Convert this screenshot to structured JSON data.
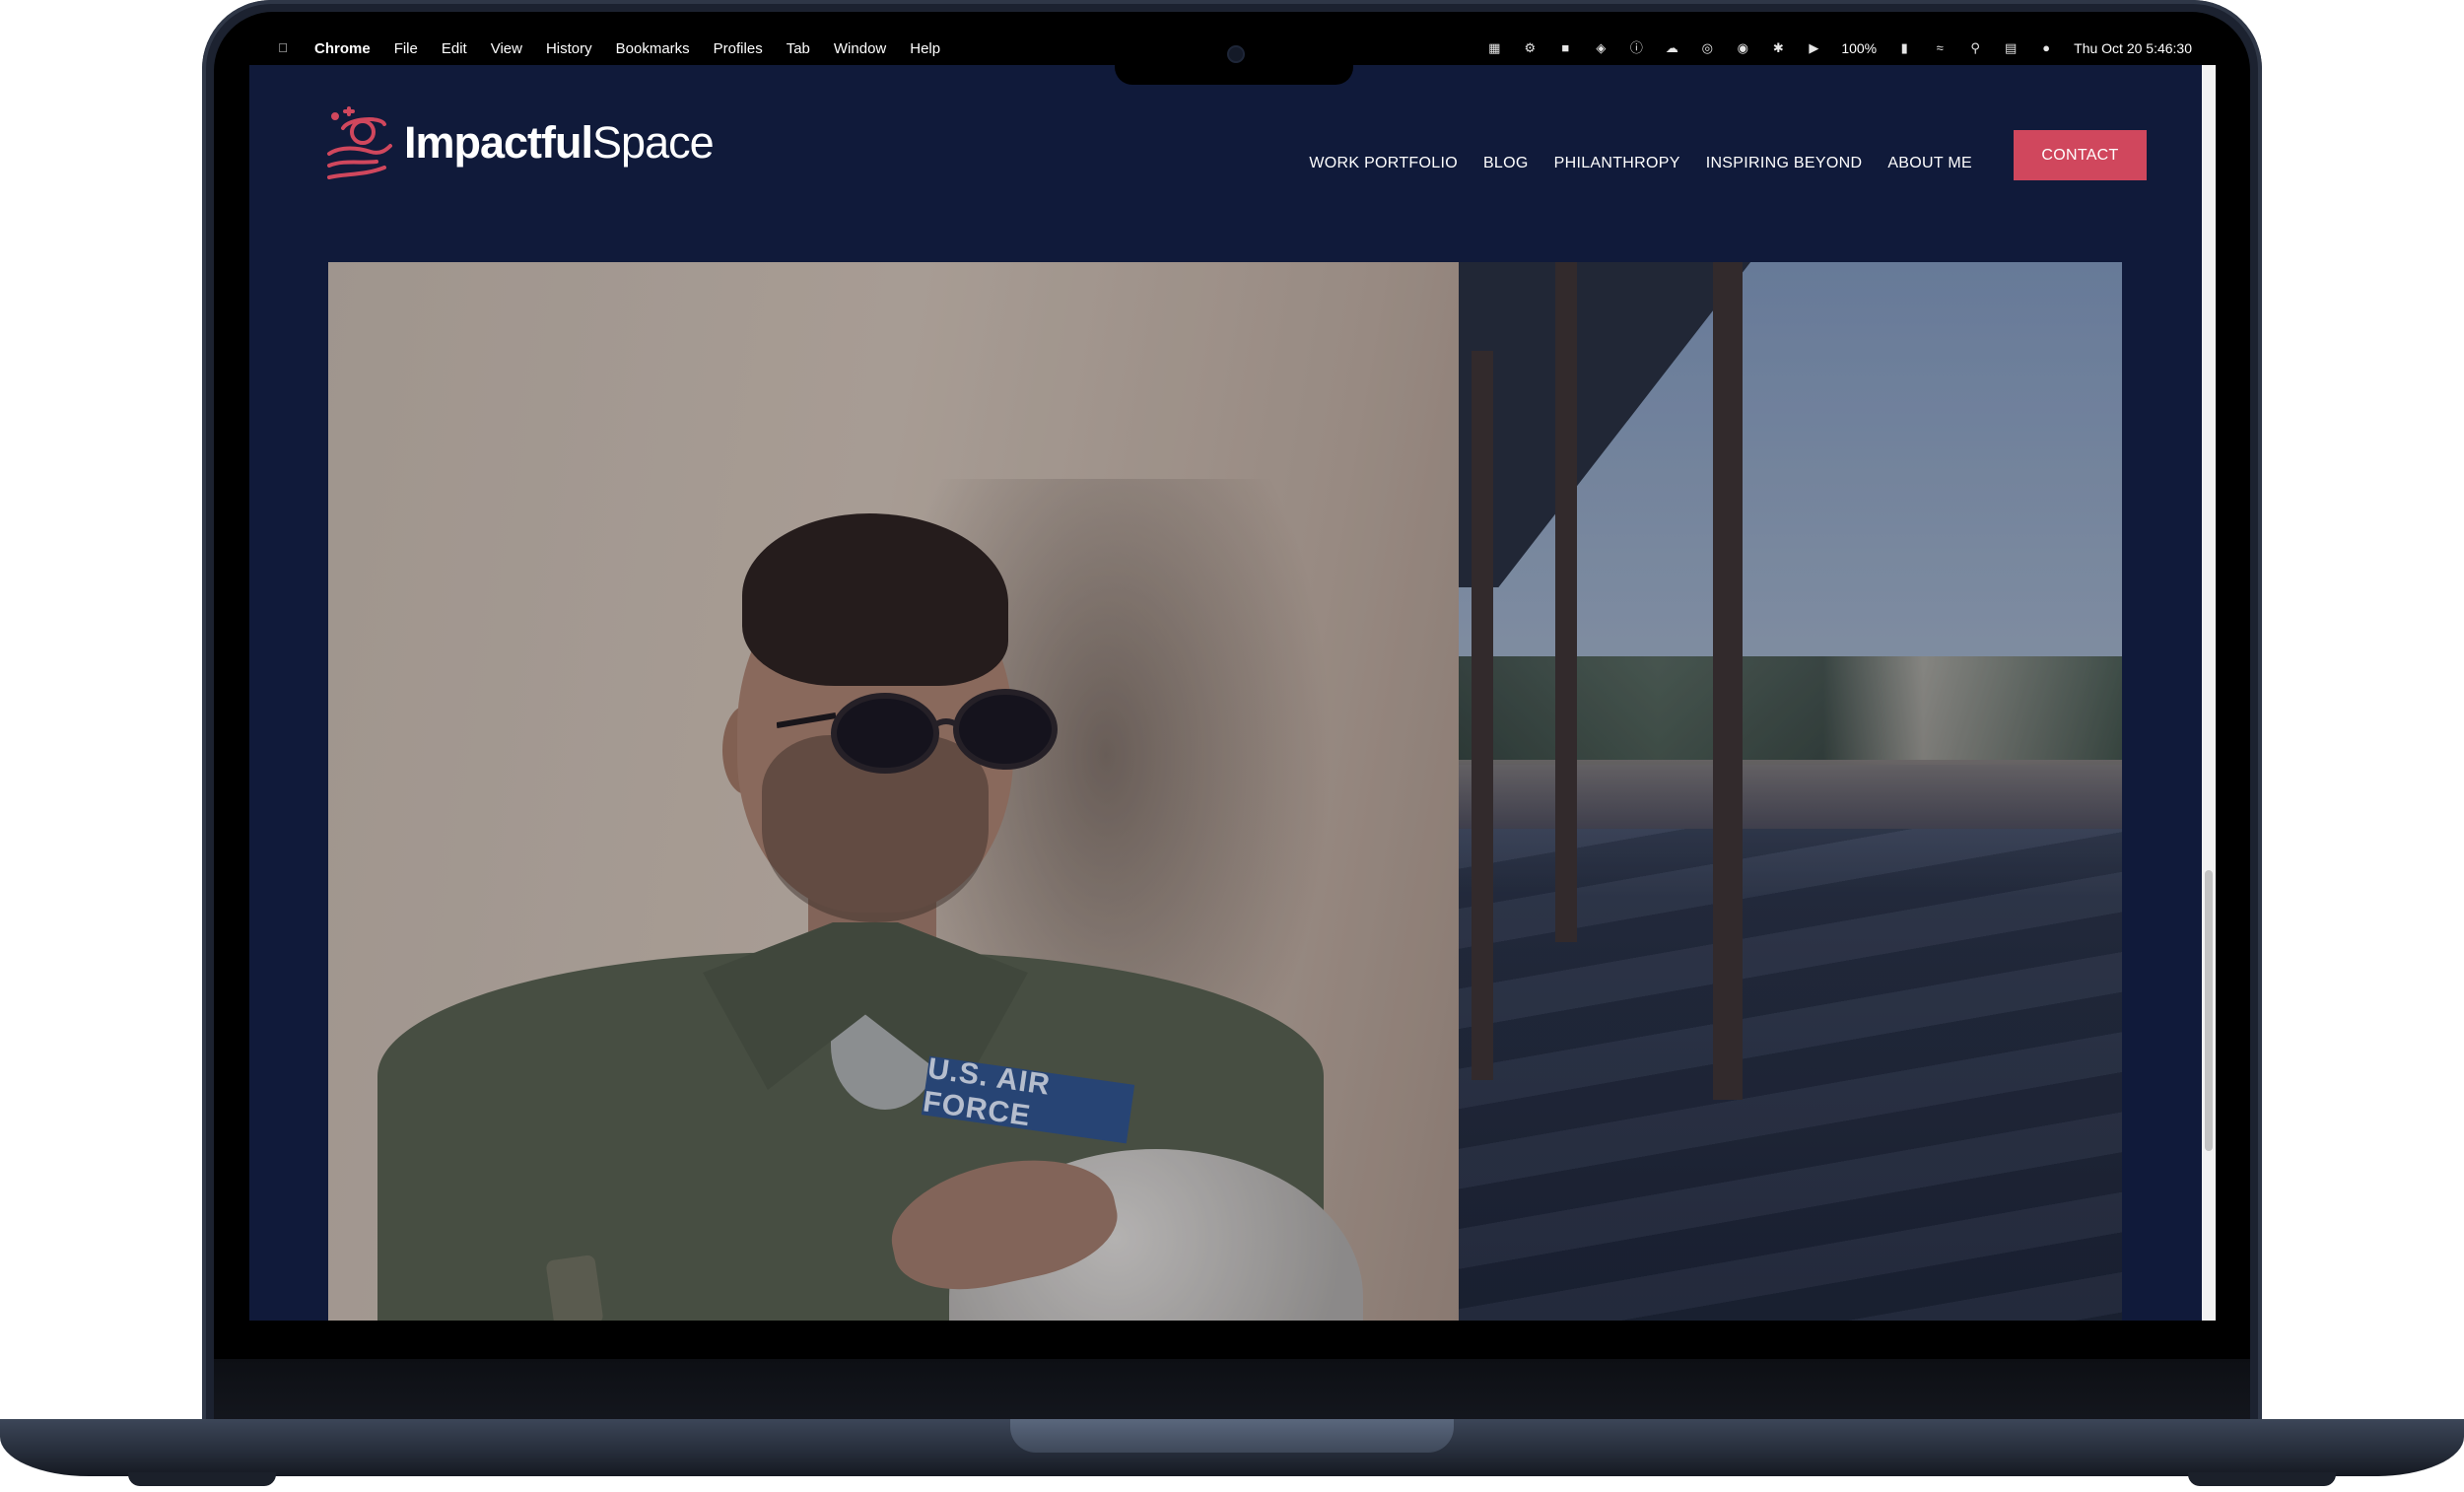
{
  "menubar": {
    "apple_icon": "apple-icon",
    "app_name": "Chrome",
    "menus": [
      "File",
      "Edit",
      "View",
      "History",
      "Bookmarks",
      "Profiles",
      "Tab",
      "Window",
      "Help"
    ],
    "battery": "100%",
    "datetime": "Thu Oct 20  5:46:30"
  },
  "site": {
    "logo": {
      "bold": "Impactful",
      "light": "Space"
    },
    "nav": [
      "WORK PORTFOLIO",
      "BLOG",
      "PHILANTHROPY",
      "INSPIRING BEYOND",
      "ABOUT ME"
    ],
    "cta": "CONTACT",
    "photo": {
      "patch_text": "U.S. AIR FORCE"
    }
  },
  "colors": {
    "site_bg": "#101a3a",
    "accent": "#d0475d",
    "logo_icon": "#d0475d"
  }
}
